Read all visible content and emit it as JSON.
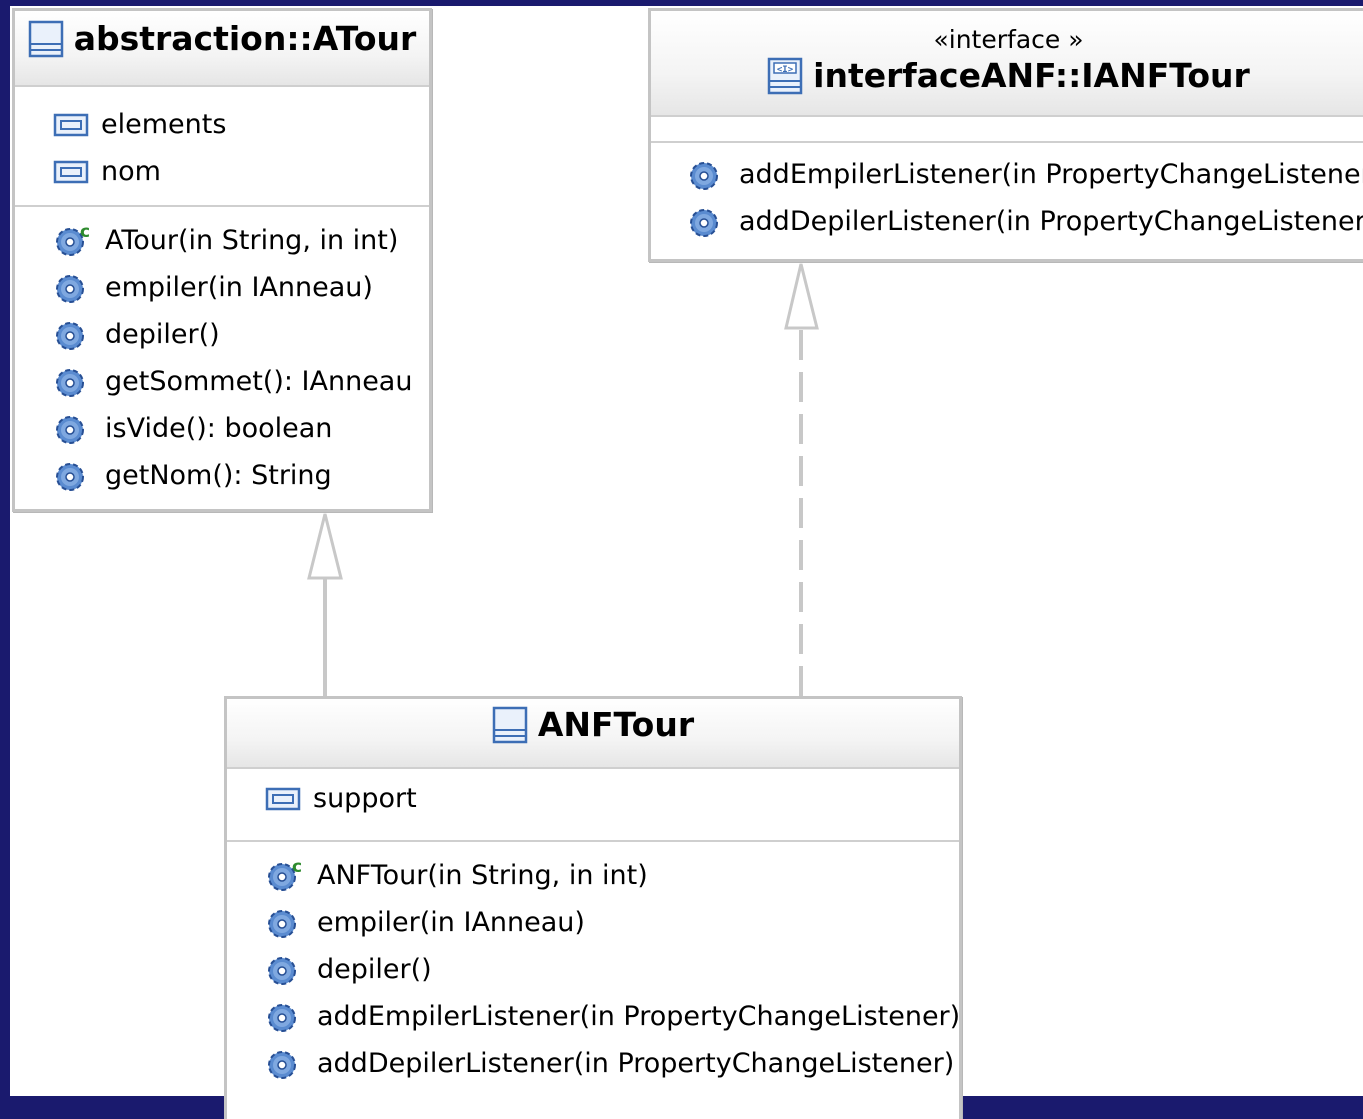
{
  "classes": {
    "atour": {
      "name": "abstraction::ATour",
      "attributes": [
        "elements",
        "nom"
      ],
      "operations": [
        {
          "label": "ATour(in String, in int)",
          "icon": "constructor-gear-icon"
        },
        {
          "label": "empiler(in IAnneau)",
          "icon": "method-gear-icon"
        },
        {
          "label": "depiler()",
          "icon": "method-gear-icon"
        },
        {
          "label": "getSommet(): IAnneau",
          "icon": "method-gear-icon"
        },
        {
          "label": "isVide(): boolean",
          "icon": "method-gear-icon"
        },
        {
          "label": "getNom(): String",
          "icon": "method-gear-icon"
        }
      ]
    },
    "ianftour": {
      "stereotype": "«interface »",
      "name": "interfaceANF::IANFTour",
      "attributes": [],
      "operations": [
        {
          "label": "addEmpilerListener(in PropertyChangeListener)",
          "icon": "method-gear-icon"
        },
        {
          "label": "addDepilerListener(in PropertyChangeListener)",
          "icon": "method-gear-icon"
        }
      ]
    },
    "anftour": {
      "name": "ANFTour",
      "attributes": [
        "support"
      ],
      "operations": [
        {
          "label": "ANFTour(in String, in int)",
          "icon": "constructor-gear-icon"
        },
        {
          "label": "empiler(in IAnneau)",
          "icon": "method-gear-icon"
        },
        {
          "label": "depiler()",
          "icon": "method-gear-icon"
        },
        {
          "label": "addEmpilerListener(in PropertyChangeListener)",
          "icon": "method-gear-icon"
        },
        {
          "label": "addDepilerListener(in PropertyChangeListener)",
          "icon": "method-gear-icon"
        }
      ]
    }
  },
  "relations": [
    {
      "type": "generalization",
      "from": "ANFTour",
      "to": "abstraction::ATour"
    },
    {
      "type": "realization",
      "from": "ANFTour",
      "to": "interfaceANF::IANFTour"
    }
  ],
  "colors": {
    "background": "#1a1a6e",
    "box_border": "#c4c4c4",
    "connector": "#c8c8c8",
    "gear": "#3a6db8",
    "constructor_marker": "#2e8b2e"
  }
}
